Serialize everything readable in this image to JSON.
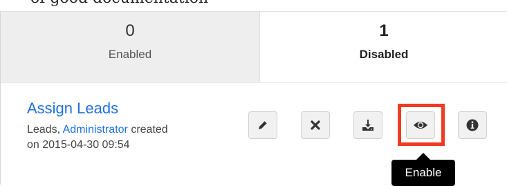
{
  "page_caption": "of good documentation",
  "tabs": [
    {
      "count": "0",
      "label": "Enabled"
    },
    {
      "count": "1",
      "label": "Disabled"
    }
  ],
  "item": {
    "title": "Assign Leads",
    "module": "Leads,",
    "user": "Administrator",
    "created_prefix": "created",
    "created_line2": "on 2015-04-30 09:54"
  },
  "actions": {
    "edit_icon": "pencil-icon",
    "delete_icon": "times-icon",
    "download_icon": "download-icon",
    "enable_icon": "eye-icon",
    "info_icon": "info-circle-icon"
  },
  "tooltip": {
    "text": "Enable"
  },
  "colors": {
    "link": "#1f6fde",
    "highlight": "#ee3b22",
    "button_bg": "#f1f1f1",
    "tooltip_bg": "#000000"
  }
}
